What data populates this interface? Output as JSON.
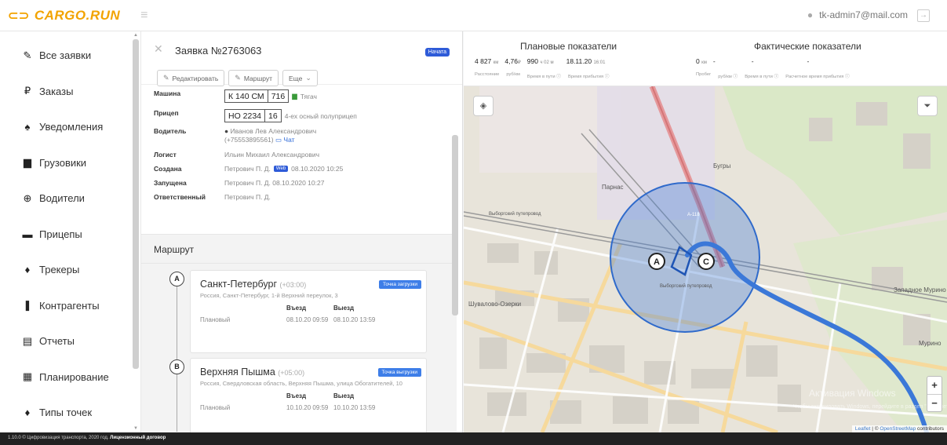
{
  "header": {
    "logo_text": "CARGO.RUN",
    "user_email": "tk-admin7@mail.com"
  },
  "sidebar": {
    "items": [
      {
        "label": "Все заявки",
        "icon": "edit-icon"
      },
      {
        "label": "Заказы",
        "icon": "ruble-icon"
      },
      {
        "label": "Уведомления",
        "icon": "bell-icon"
      },
      {
        "label": "Грузовики",
        "icon": "truck-icon"
      },
      {
        "label": "Водители",
        "icon": "steering-wheel-icon"
      },
      {
        "label": "Прицепы",
        "icon": "trailer-icon"
      },
      {
        "label": "Трекеры",
        "icon": "map-pin-icon"
      },
      {
        "label": "Контрагенты",
        "icon": "contacts-icon"
      },
      {
        "label": "Отчеты",
        "icon": "report-icon"
      },
      {
        "label": "Планирование",
        "icon": "calendar-icon"
      },
      {
        "label": "Типы точек",
        "icon": "location-icon"
      }
    ]
  },
  "order": {
    "title": "Заявка №2763063",
    "status_badge": "Начата",
    "buttons": {
      "edit": "Редактировать",
      "route": "Маршрут",
      "more": "Еще"
    },
    "props": {
      "vehicle_label": "Машина",
      "vehicle_plate_main": "К 140 СМ",
      "vehicle_plate_region": "716",
      "vehicle_type": "Тягач",
      "trailer_label": "Прицеп",
      "trailer_plate_main": "НО 2234",
      "trailer_plate_region": "16",
      "trailer_type": "4-ех осный полуприцеп",
      "driver_label": "Водитель",
      "driver_name": "Иванов Лев Александрович",
      "driver_phone": "(+75553895561)",
      "driver_chat": "Чат",
      "logist_label": "Логист",
      "logist_name": "Ильин Михаил Александрович",
      "created_label": "Создана",
      "created_by": "Петрович П. Д.",
      "created_tag": "Web",
      "created_at": "08.10.2020 10:25",
      "launched_label": "Запущена",
      "launched_value": "Петрович П. Д. 08.10.2020 10:27",
      "responsible_label": "Ответственный",
      "responsible_value": "Петрович П. Д."
    }
  },
  "route": {
    "heading": "Маршрут",
    "points": [
      {
        "letter": "A",
        "city": "Санкт-Петербург",
        "tz": "(+03:00)",
        "badge": "Точка загрузки",
        "address": "Россия, Санкт-Петербург, 1-й Верхний переулок, 3",
        "col_in": "Въезд",
        "col_out": "Выезд",
        "row_label": "Плановый",
        "in": "08.10.20 09:59",
        "out": "08.10.20 13:59"
      },
      {
        "letter": "B",
        "city": "Верхняя Пышма",
        "tz": "(+05:00)",
        "badge": "Точка выгрузки",
        "address": "Россия, Свердловская область, Верхняя Пышма, улица Обогатителей, 10",
        "col_in": "Въезд",
        "col_out": "Выезд",
        "row_label": "Плановый",
        "in": "10.10.20 09:59",
        "out": "10.10.20 13:59"
      }
    ]
  },
  "metrics": {
    "planned_title": "Плановые показатели",
    "actual_title": "Фактические показатели",
    "planned": {
      "distance": "4 827",
      "distance_unit": "км",
      "rub_km": "4,76",
      "rub_km_unit": "₽",
      "travel_time": "990",
      "travel_time_unit": "ч 02 м",
      "arrival": "18.11.20",
      "arrival_time": "16:01",
      "labels": [
        "Расстояние",
        "руб/км",
        "Время в пути ⓘ",
        "Время прибытия ⓘ"
      ]
    },
    "actual": {
      "mileage": "0",
      "mileage_unit": "км",
      "rub_km": "-",
      "travel_time": "-",
      "arrival": "-",
      "labels": [
        "Пробег",
        "руб/км ⓘ",
        "Время в пути ⓘ",
        "Расчетное время прибытия ⓘ"
      ]
    }
  },
  "map": {
    "labels": {
      "burgry": "Бугры",
      "parnas": "Парнас",
      "shuvalovo": "Шувалово-Озерки",
      "zapadnoe": "Западное Мурино",
      "murino": "Мурино",
      "vyborg": "Выборгский путепровод",
      "road": "А-118",
      "vyborg_left": "Выборгский путепровод"
    },
    "marker_a": "A",
    "marker_c": "C",
    "attribution_leaflet": "Leaflet",
    "attribution_osm": "OpenStreetMap",
    "attribution_tail": "contributors",
    "watermark_1": "Активация Windows",
    "watermark_2": "Чтобы активировать Windows, перейдите в раздел \"Параметры\"."
  },
  "footer": {
    "text": "1.10.0 © Цифровизация транспорта, 2020 год.",
    "link": "Лицензионный договор"
  },
  "colors": {
    "brand": "#f2a300",
    "accent": "#2e5bd8",
    "route": "#3b78d8"
  }
}
